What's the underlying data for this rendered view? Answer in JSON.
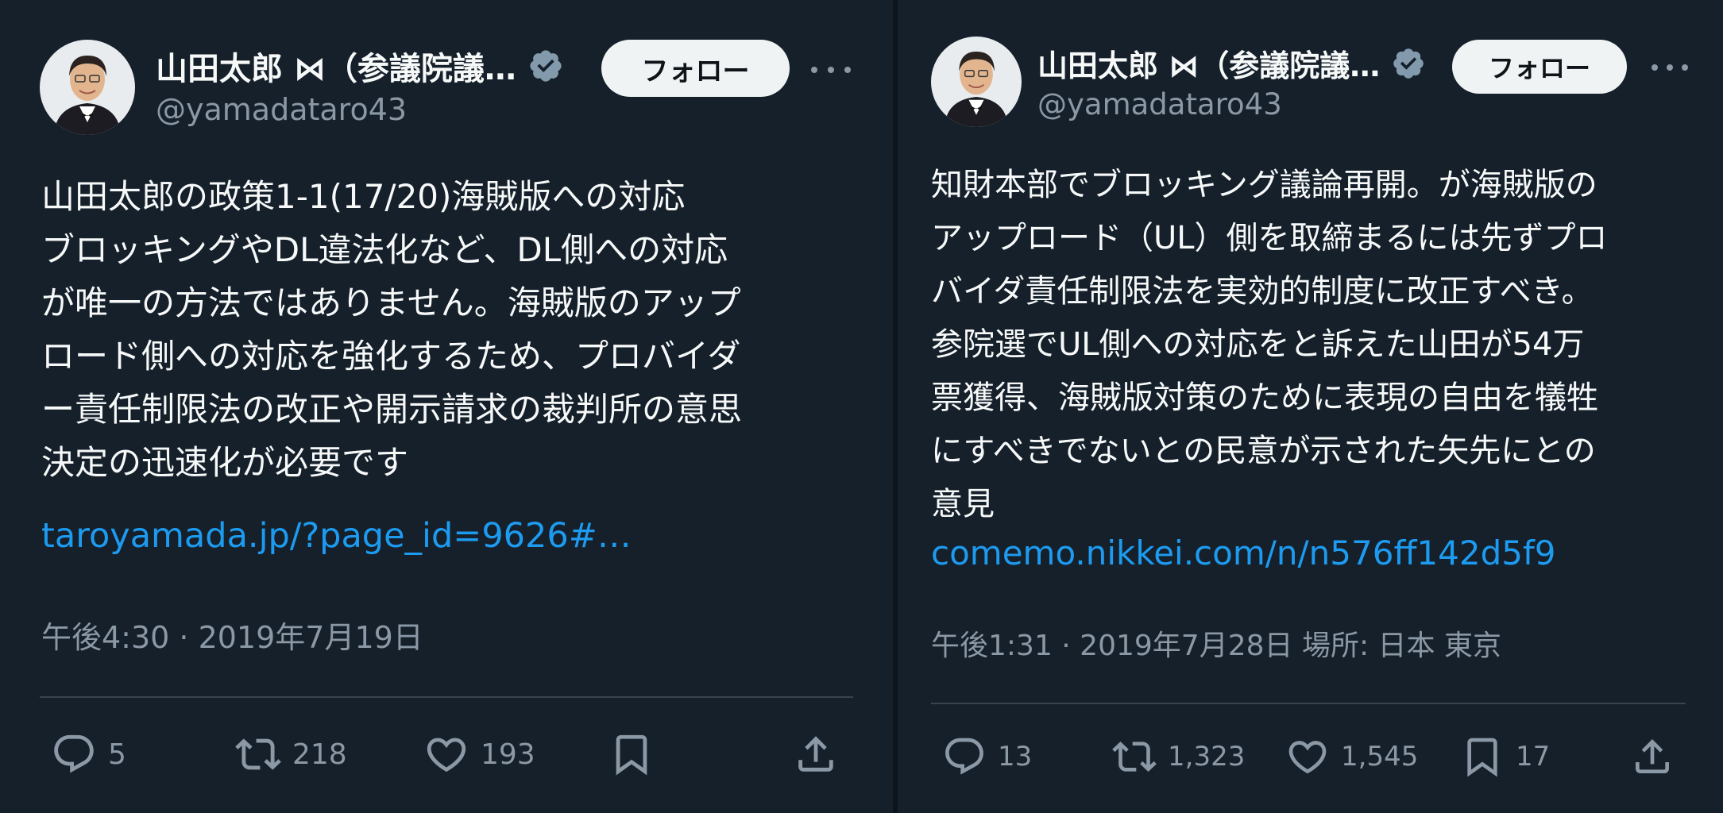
{
  "tweets": [
    {
      "author": {
        "name": "山田太郎 ⋈（参議院議…",
        "handle": "@yamadataro43"
      },
      "follow_label": "フォロー",
      "text": "山田太郎の政策1-1(17/20)海賊版への対応\nブロッキングやDL違法化など、DL側への対応\nが唯一の方法ではありません。海賊版のアップ\nロード側への対応を強化するため、プロバイダ\nー責任制限法の改正や開示請求の裁判所の意思\n決定の迅速化が必要です",
      "link": "taroyamada.jp/?page_id=9626#…",
      "meta": "午後4:30 · 2019年7月19日",
      "counts": {
        "replies": "5",
        "retweets": "218",
        "likes": "193",
        "bookmarks": ""
      }
    },
    {
      "author": {
        "name": "山田太郎 ⋈（参議院議…",
        "handle": "@yamadataro43"
      },
      "follow_label": "フォロー",
      "text": "知財本部でブロッキング議論再開。が海賊版の\nアップロード（UL）側を取締まるには先ずプロ\nバイダ責任制限法を実効的制度に改正すべき。\n参院選でUL側への対応をと訴えた山田が54万\n票獲得、海賊版対策のために表現の自由を犠牲\nにすべきでないとの民意が示された矢先にとの\n意見",
      "link": "comemo.nikkei.com/n/n576ff142d5f9",
      "meta": "午後1:31 · 2019年7月28日 場所: 日本 東京",
      "counts": {
        "replies": "13",
        "retweets": "1,323",
        "likes": "1,545",
        "bookmarks": "17"
      }
    }
  ],
  "icons": {
    "verified": "verified-badge-icon",
    "more": "more-dots-icon",
    "reply": "reply-bubble-icon",
    "retweet": "retweet-arrows-icon",
    "like": "heart-icon",
    "bookmark": "bookmark-icon",
    "share": "share-upload-icon"
  },
  "colors": {
    "background": "#15202b",
    "text": "#f7f9f9",
    "secondary": "#8b98a5",
    "link": "#1d9bf0",
    "divider": "#38444d",
    "verified": "#829aab"
  }
}
